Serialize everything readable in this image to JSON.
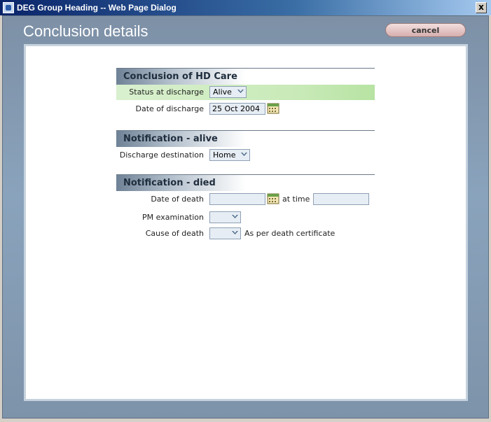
{
  "window": {
    "title": "DEG Group Heading -- Web Page Dialog",
    "close_label": "x"
  },
  "dialog": {
    "title": "Conclusion details",
    "cancel_label": "cancel"
  },
  "sections": {
    "conclusion": {
      "heading": "Conclusion of HD Care",
      "status_label": "Status at discharge",
      "status_value": "Alive",
      "date_label": "Date of discharge",
      "date_value": "25 Oct 2004"
    },
    "alive": {
      "heading": "Notification - alive",
      "destination_label": "Discharge destination",
      "destination_value": "Home"
    },
    "died": {
      "heading": "Notification - died",
      "date_label": "Date of death",
      "date_value": "",
      "at_time_label": "at time",
      "time_value": "",
      "pm_label": "PM examination",
      "pm_value": "",
      "cause_label": "Cause of death",
      "cause_value": "",
      "cause_note": "As per death certificate"
    }
  },
  "colors": {
    "highlight_row": "#c9eab8",
    "field_bg": "#e6edf4",
    "dialog_bg": "#8aa3bc"
  }
}
